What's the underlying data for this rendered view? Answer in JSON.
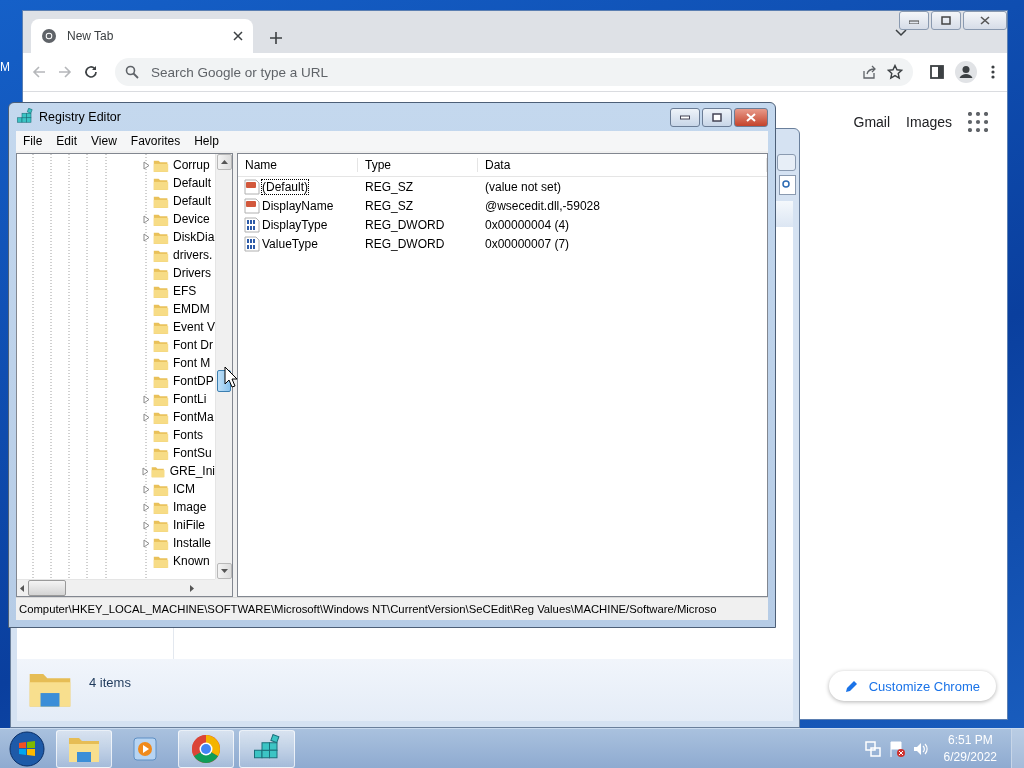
{
  "desktop": {
    "icon_label": "M"
  },
  "chrome": {
    "tabs": [
      {
        "title": "New Tab",
        "selected": true
      }
    ],
    "omnibox": {
      "placeholder": "Search Google or type a URL"
    },
    "links": [
      "Gmail",
      "Images"
    ],
    "customize_button": "Customize Chrome"
  },
  "explorer": {
    "status": "4 items"
  },
  "regedit": {
    "title": "Registry Editor",
    "menu": [
      "File",
      "Edit",
      "View",
      "Favorites",
      "Help"
    ],
    "tree": [
      {
        "label": "Corrup",
        "has_children": true
      },
      {
        "label": "Default",
        "has_children": false
      },
      {
        "label": "Default",
        "has_children": false
      },
      {
        "label": "Device",
        "has_children": true
      },
      {
        "label": "DiskDia",
        "has_children": true
      },
      {
        "label": "drivers.",
        "has_children": false
      },
      {
        "label": "Drivers",
        "has_children": false
      },
      {
        "label": "EFS",
        "has_children": false
      },
      {
        "label": "EMDM",
        "has_children": false
      },
      {
        "label": "Event V",
        "has_children": false
      },
      {
        "label": "Font Dr",
        "has_children": false
      },
      {
        "label": "Font M",
        "has_children": false
      },
      {
        "label": "FontDP",
        "has_children": false
      },
      {
        "label": "FontLi",
        "has_children": true
      },
      {
        "label": "FontMa",
        "has_children": true
      },
      {
        "label": "Fonts",
        "has_children": false
      },
      {
        "label": "FontSu",
        "has_children": false
      },
      {
        "label": "GRE_Ini",
        "has_children": true
      },
      {
        "label": "ICM",
        "has_children": true
      },
      {
        "label": "Image",
        "has_children": true
      },
      {
        "label": "IniFile",
        "has_children": true
      },
      {
        "label": "Installe",
        "has_children": true
      },
      {
        "label": "Known",
        "has_children": false
      }
    ],
    "columns": [
      "Name",
      "Type",
      "Data"
    ],
    "values": [
      {
        "name": "(Default)",
        "type": "REG_SZ",
        "data": "(value not set)",
        "kind": "string",
        "focused": true
      },
      {
        "name": "DisplayName",
        "type": "REG_SZ",
        "data": "@wsecedit.dll,-59028",
        "kind": "string",
        "focused": false
      },
      {
        "name": "DisplayType",
        "type": "REG_DWORD",
        "data": "0x00000004 (4)",
        "kind": "binary",
        "focused": false
      },
      {
        "name": "ValueType",
        "type": "REG_DWORD",
        "data": "0x00000007 (7)",
        "kind": "binary",
        "focused": false
      }
    ],
    "status_path": "Computer\\HKEY_LOCAL_MACHINE\\SOFTWARE\\Microsoft\\Windows NT\\CurrentVersion\\SeCEdit\\Reg Values\\MACHINE/Software/Microso"
  },
  "taskbar": {
    "buttons": [
      {
        "kind": "explorer",
        "open": true
      },
      {
        "kind": "media",
        "open": false
      },
      {
        "kind": "chrome",
        "open": true
      },
      {
        "kind": "regedit",
        "open": true
      }
    ],
    "time": "6:51 PM",
    "date": "6/29/2022"
  }
}
